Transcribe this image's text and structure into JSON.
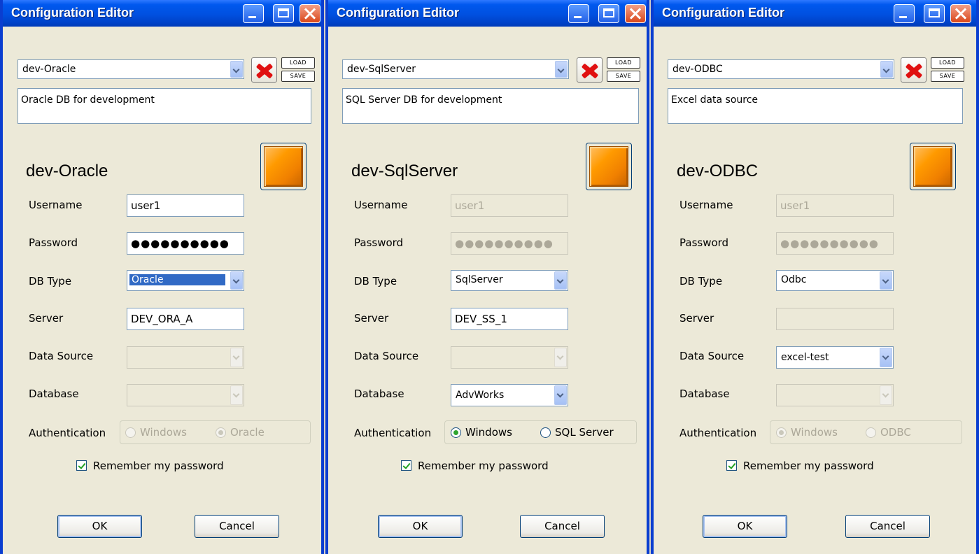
{
  "windows": [
    {
      "title": "Configuration Editor",
      "profile_value": "dev-Oracle",
      "load_label": "LOAD",
      "save_label": "SAVE",
      "description": "Oracle DB for development",
      "connection_name": "dev-Oracle",
      "username_label": "Username",
      "username_value": "user1",
      "password_label": "Password",
      "password_mask": "●●●●●●●●●●",
      "dbtype_label": "DB Type",
      "dbtype_value": "Oracle",
      "server_label": "Server",
      "server_value": "DEV_ORA_A",
      "datasource_label": "Data Source",
      "datasource_value": "",
      "database_label": "Database",
      "database_value": "",
      "auth_label": "Authentication",
      "auth_option1": "Windows",
      "auth_option2": "Oracle",
      "auth_selected": "Oracle",
      "remember_label": "Remember my password",
      "remember_checked": true,
      "ok_label": "OK",
      "cancel_label": "Cancel"
    },
    {
      "title": "Configuration Editor",
      "profile_value": "dev-SqlServer",
      "load_label": "LOAD",
      "save_label": "SAVE",
      "description": "SQL Server DB for development",
      "connection_name": "dev-SqlServer",
      "username_label": "Username",
      "username_value": "user1",
      "password_label": "Password",
      "password_mask": "●●●●●●●●●●",
      "dbtype_label": "DB Type",
      "dbtype_value": "SqlServer",
      "server_label": "Server",
      "server_value": "DEV_SS_1",
      "datasource_label": "Data Source",
      "datasource_value": "",
      "database_label": "Database",
      "database_value": "AdvWorks",
      "auth_label": "Authentication",
      "auth_option1": "Windows",
      "auth_option2": "SQL Server",
      "auth_selected": "Windows",
      "remember_label": "Remember my password",
      "remember_checked": true,
      "ok_label": "OK",
      "cancel_label": "Cancel"
    },
    {
      "title": "Configuration Editor",
      "profile_value": "dev-ODBC",
      "load_label": "LOAD",
      "save_label": "SAVE",
      "description": "Excel data source",
      "connection_name": "dev-ODBC",
      "username_label": "Username",
      "username_value": "user1",
      "password_label": "Password",
      "password_mask": "●●●●●●●●●●",
      "dbtype_label": "DB Type",
      "dbtype_value": "Odbc",
      "server_label": "Server",
      "server_value": "",
      "datasource_label": "Data Source",
      "datasource_value": "excel-test",
      "database_label": "Database",
      "database_value": "",
      "auth_label": "Authentication",
      "auth_option1": "Windows",
      "auth_option2": "ODBC",
      "auth_selected": "Windows",
      "remember_label": "Remember my password",
      "remember_checked": true,
      "ok_label": "OK",
      "cancel_label": "Cancel"
    }
  ],
  "icons": {
    "minimize": "minimize-icon",
    "maximize": "maximize-icon",
    "close": "close-icon",
    "delete": "delete-x-icon"
  },
  "colors": {
    "titlebar": "#0054e3",
    "window_border": "#0a3ed0",
    "dialog_bg": "#ece9d8",
    "selection": "#316ac5",
    "status_button": "#ff9a00",
    "delete_red": "#e01010"
  }
}
